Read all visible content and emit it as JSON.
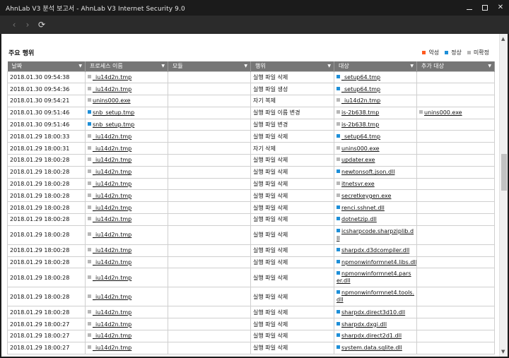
{
  "window": {
    "title": "AhnLab V3 분석 보고서 - AhnLab V3 Internet Security 9.0"
  },
  "section": {
    "title": "주요 행위"
  },
  "legend": [
    {
      "label": "악성",
      "color": "#ff5a1f"
    },
    {
      "label": "정상",
      "color": "#1e8fd8"
    },
    {
      "label": "미확정",
      "color": "#b7b7b7"
    }
  ],
  "columns": [
    "날짜",
    "프로세스 이름",
    "모듈",
    "행위",
    "대상",
    "추가 대상"
  ],
  "rows": [
    {
      "date": "2018.01.30 09:54:38",
      "proc": "_iu14d2n.tmp",
      "proc_color": "#b7b7b7",
      "module": "",
      "action": "실행 파일 삭제",
      "target": "_setup64.tmp",
      "target_color": "#1e8fd8",
      "extra": "",
      "extra_color": ""
    },
    {
      "date": "2018.01.30 09:54:36",
      "proc": "_iu14d2n.tmp",
      "proc_color": "#b7b7b7",
      "module": "",
      "action": "실행 파일 생성",
      "target": "_setup64.tmp",
      "target_color": "#1e8fd8",
      "extra": "",
      "extra_color": ""
    },
    {
      "date": "2018.01.30 09:54:21",
      "proc": "unins000.exe",
      "proc_color": "#b7b7b7",
      "module": "",
      "action": "자기 복제",
      "target": "_iu14d2n.tmp",
      "target_color": "#b7b7b7",
      "extra": "",
      "extra_color": ""
    },
    {
      "date": "2018.01.30 09:51:46",
      "proc": "snb_setup.tmp",
      "proc_color": "#1e8fd8",
      "module": "",
      "action": "실행 파일 이름 변경",
      "target": "is-2b638.tmp",
      "target_color": "#b7b7b7",
      "extra": "unins000.exe",
      "extra_color": "#b7b7b7"
    },
    {
      "date": "2018.01.30 09:51:46",
      "proc": "snb_setup.tmp",
      "proc_color": "#1e8fd8",
      "module": "",
      "action": "실행 파일 변경",
      "target": "is-2b638.tmp",
      "target_color": "#b7b7b7",
      "extra": "",
      "extra_color": ""
    },
    {
      "date": "2018.01.29 18:00:33",
      "proc": "_iu14d2n.tmp",
      "proc_color": "#b7b7b7",
      "module": "",
      "action": "실행 파일 삭제",
      "target": "_setup64.tmp",
      "target_color": "#1e8fd8",
      "extra": "",
      "extra_color": ""
    },
    {
      "date": "2018.01.29 18:00:31",
      "proc": "_iu14d2n.tmp",
      "proc_color": "#b7b7b7",
      "module": "",
      "action": "자기 삭제",
      "target": "unins000.exe",
      "target_color": "#b7b7b7",
      "extra": "",
      "extra_color": ""
    },
    {
      "date": "2018.01.29 18:00:28",
      "proc": "_iu14d2n.tmp",
      "proc_color": "#b7b7b7",
      "module": "",
      "action": "실행 파일 삭제",
      "target": "updater.exe",
      "target_color": "#b7b7b7",
      "extra": "",
      "extra_color": ""
    },
    {
      "date": "2018.01.29 18:00:28",
      "proc": "_iu14d2n.tmp",
      "proc_color": "#b7b7b7",
      "module": "",
      "action": "실행 파일 삭제",
      "target": "newtonsoft.json.dll",
      "target_color": "#1e8fd8",
      "extra": "",
      "extra_color": ""
    },
    {
      "date": "2018.01.29 18:00:28",
      "proc": "_iu14d2n.tmp",
      "proc_color": "#b7b7b7",
      "module": "",
      "action": "실행 파일 삭제",
      "target": "itnetsvr.exe",
      "target_color": "#b7b7b7",
      "extra": "",
      "extra_color": ""
    },
    {
      "date": "2018.01.29 18:00:28",
      "proc": "_iu14d2n.tmp",
      "proc_color": "#b7b7b7",
      "module": "",
      "action": "실행 파일 삭제",
      "target": "secretkeygen.exe",
      "target_color": "#b7b7b7",
      "extra": "",
      "extra_color": ""
    },
    {
      "date": "2018.01.29 18:00:28",
      "proc": "_iu14d2n.tmp",
      "proc_color": "#b7b7b7",
      "module": "",
      "action": "실행 파일 삭제",
      "target": "renci.sshnet.dll",
      "target_color": "#1e8fd8",
      "extra": "",
      "extra_color": ""
    },
    {
      "date": "2018.01.29 18:00:28",
      "proc": "_iu14d2n.tmp",
      "proc_color": "#b7b7b7",
      "module": "",
      "action": "실행 파일 삭제",
      "target": "dotnetzip.dll",
      "target_color": "#1e8fd8",
      "extra": "",
      "extra_color": ""
    },
    {
      "date": "2018.01.29 18:00:28",
      "proc": "_iu14d2n.tmp",
      "proc_color": "#b7b7b7",
      "module": "",
      "action": "실행 파일 삭제",
      "target": "icsharpcode.sharpziplib.dll",
      "target_color": "#1e8fd8",
      "extra": "",
      "extra_color": "",
      "tall": true
    },
    {
      "date": "2018.01.29 18:00:28",
      "proc": "_iu14d2n.tmp",
      "proc_color": "#b7b7b7",
      "module": "",
      "action": "실행 파일 삭제",
      "target": "sharpdx.d3dcompiler.dll",
      "target_color": "#1e8fd8",
      "extra": "",
      "extra_color": ""
    },
    {
      "date": "2018.01.29 18:00:28",
      "proc": "_iu14d2n.tmp",
      "proc_color": "#b7b7b7",
      "module": "",
      "action": "실행 파일 삭제",
      "target": "npmonwinformnet4.libs.dll",
      "target_color": "#1e8fd8",
      "extra": "",
      "extra_color": ""
    },
    {
      "date": "2018.01.29 18:00:28",
      "proc": "_iu14d2n.tmp",
      "proc_color": "#b7b7b7",
      "module": "",
      "action": "실행 파일 삭제",
      "target": "npmonwinformnet4.parser.dll",
      "target_color": "#1e8fd8",
      "extra": "",
      "extra_color": "",
      "tall": true
    },
    {
      "date": "2018.01.29 18:00:28",
      "proc": "_iu14d2n.tmp",
      "proc_color": "#b7b7b7",
      "module": "",
      "action": "실행 파일 삭제",
      "target": "npmonwinformnet4.tools.dll",
      "target_color": "#1e8fd8",
      "extra": "",
      "extra_color": "",
      "tall": true
    },
    {
      "date": "2018.01.29 18:00:28",
      "proc": "_iu14d2n.tmp",
      "proc_color": "#b7b7b7",
      "module": "",
      "action": "실행 파일 삭제",
      "target": "sharpdx.direct3d10.dll",
      "target_color": "#1e8fd8",
      "extra": "",
      "extra_color": ""
    },
    {
      "date": "2018.01.29 18:00:27",
      "proc": "_iu14d2n.tmp",
      "proc_color": "#b7b7b7",
      "module": "",
      "action": "실행 파일 삭제",
      "target": "sharpdx.dxgi.dll",
      "target_color": "#1e8fd8",
      "extra": "",
      "extra_color": ""
    },
    {
      "date": "2018.01.29 18:00:27",
      "proc": "_iu14d2n.tmp",
      "proc_color": "#b7b7b7",
      "module": "",
      "action": "실행 파일 삭제",
      "target": "sharpdx.direct2d1.dll",
      "target_color": "#1e8fd8",
      "extra": "",
      "extra_color": ""
    },
    {
      "date": "2018.01.29 18:00:27",
      "proc": "_iu14d2n.tmp",
      "proc_color": "#b7b7b7",
      "module": "",
      "action": "실행 파일 삭제",
      "target": "system.data.sqlite.dll",
      "target_color": "#1e8fd8",
      "extra": "",
      "extra_color": ""
    }
  ]
}
